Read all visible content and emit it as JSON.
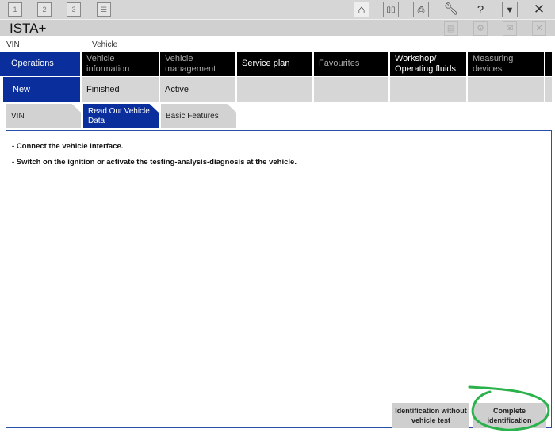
{
  "toolbar": {
    "left": [
      "1",
      "2",
      "3"
    ],
    "icons": [
      "home-icon",
      "cards-icon",
      "print-icon",
      "wrench-icon",
      "help-icon",
      "minimize-icon",
      "close-icon"
    ]
  },
  "app": {
    "title": "ISTA+"
  },
  "labels": {
    "vin": "VIN",
    "vehicle": "Vehicle"
  },
  "nav": [
    "Operations",
    "Vehicle information",
    "Vehicle management",
    "Service plan",
    "Favourites",
    "Workshop/ Operating fluids",
    "Measuring devices"
  ],
  "subnav": [
    "New",
    "Finished",
    "Active"
  ],
  "tabs": [
    "VIN",
    "Read Out Vehicle Data",
    "Basic Features"
  ],
  "content": {
    "line1": "- Connect the vehicle interface.",
    "line2": "- Switch on the ignition or activate the testing-analysis-diagnosis at the vehicle."
  },
  "buttons": {
    "without_test": "Identification without vehicle test",
    "complete": "Complete identification"
  },
  "colors": {
    "accent": "#0a2e9c",
    "annotation": "#2bb24c"
  }
}
